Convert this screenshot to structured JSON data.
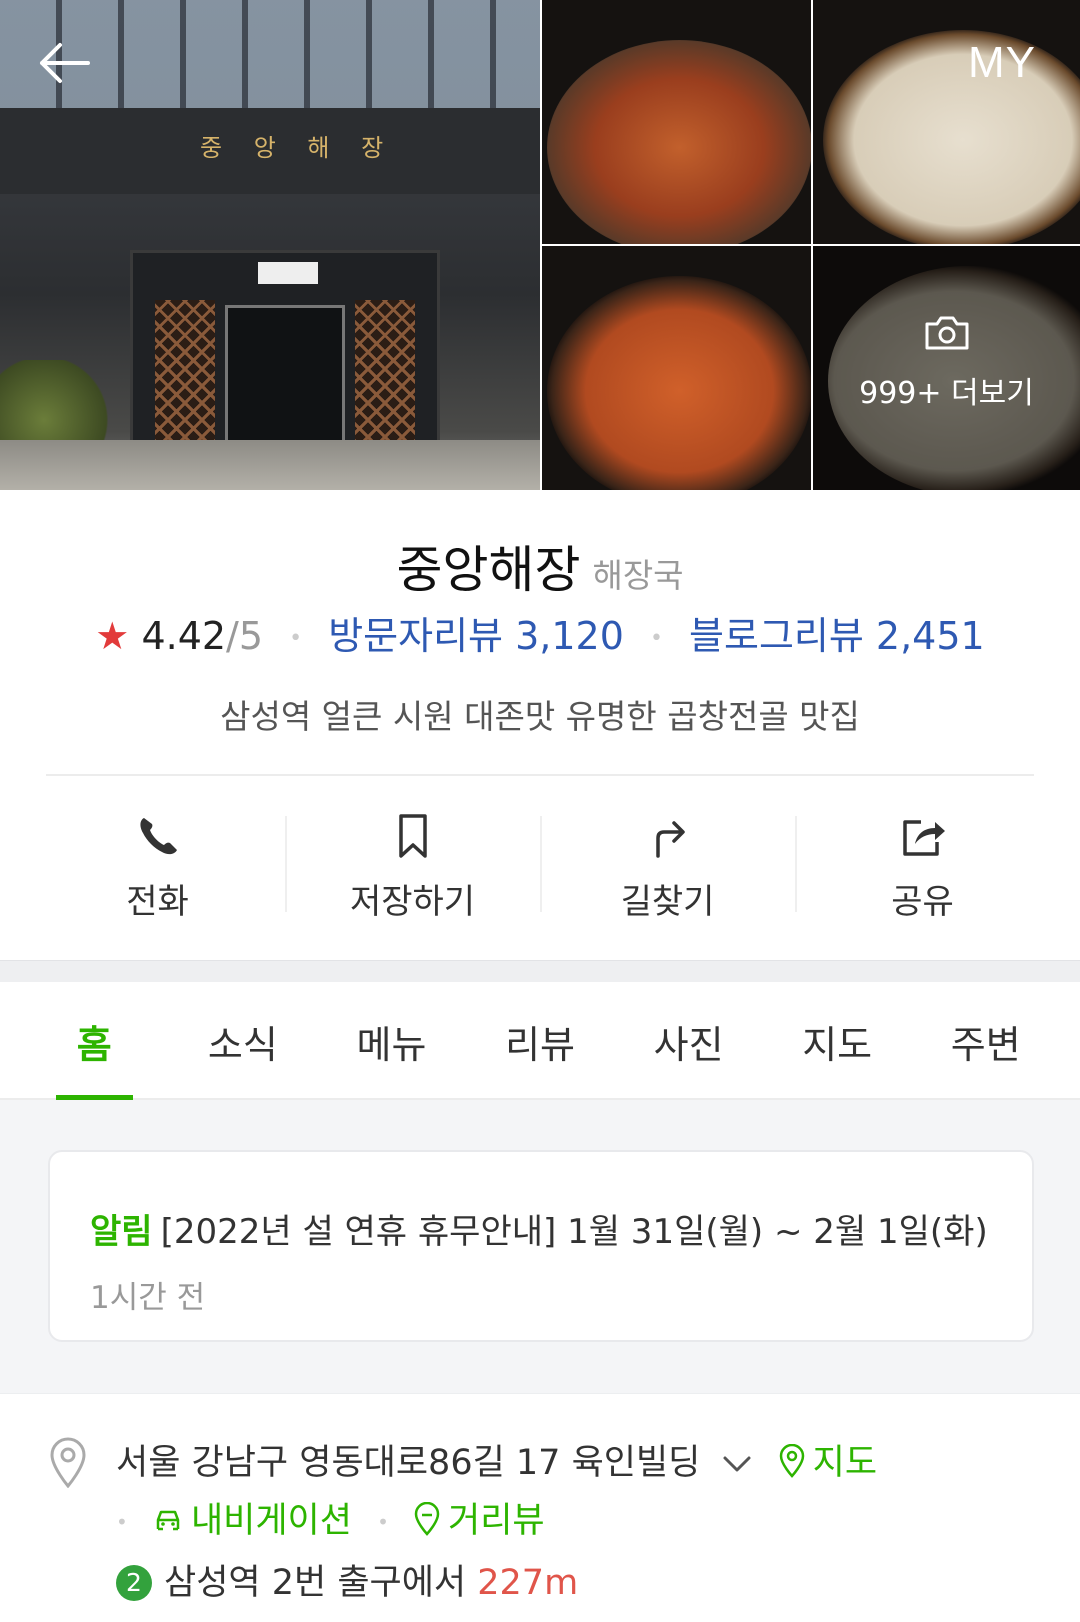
{
  "header": {
    "back_label": "←",
    "my_label": "MY",
    "storefront_sign": "중 앙 해 장",
    "more_photos_label": "999+ 더보기"
  },
  "place": {
    "name": "중앙해장",
    "category": "해장국",
    "rating": "4.42",
    "rating_max": "/5",
    "visitor_reviews": "방문자리뷰 3,120",
    "blog_reviews": "블로그리뷰 2,451",
    "description": "삼성역 얼큰 시원 대존맛 유명한 곱창전골 맛집"
  },
  "actions": [
    {
      "label": "전화",
      "icon": "phone-icon"
    },
    {
      "label": "저장하기",
      "icon": "bookmark-icon"
    },
    {
      "label": "길찾기",
      "icon": "directions-icon"
    },
    {
      "label": "공유",
      "icon": "share-icon"
    }
  ],
  "tabs": [
    {
      "label": "홈",
      "active": true
    },
    {
      "label": "소식"
    },
    {
      "label": "메뉴"
    },
    {
      "label": "리뷰"
    },
    {
      "label": "사진"
    },
    {
      "label": "지도"
    },
    {
      "label": "주변"
    }
  ],
  "notice": {
    "tag": "알림",
    "text": "[2022년 설 연휴 휴무안내] 1월 31일(월) ~ 2월 1일(화)",
    "time": "1시간 전"
  },
  "address": {
    "text": "서울 강남구 영동대로86길 17 육인빌딩",
    "map_link": "지도",
    "navigation_link": "내비게이션",
    "streetview_link": "거리뷰",
    "subway_line": "2",
    "subway_text": "삼성역 2번 출구에서",
    "distance": "227m"
  },
  "colors": {
    "accent_green": "#2db400",
    "review_blue": "#2e59b2",
    "star_red": "#e23b3b",
    "distance_red": "#e0554a",
    "line2_green": "#33a23d"
  }
}
